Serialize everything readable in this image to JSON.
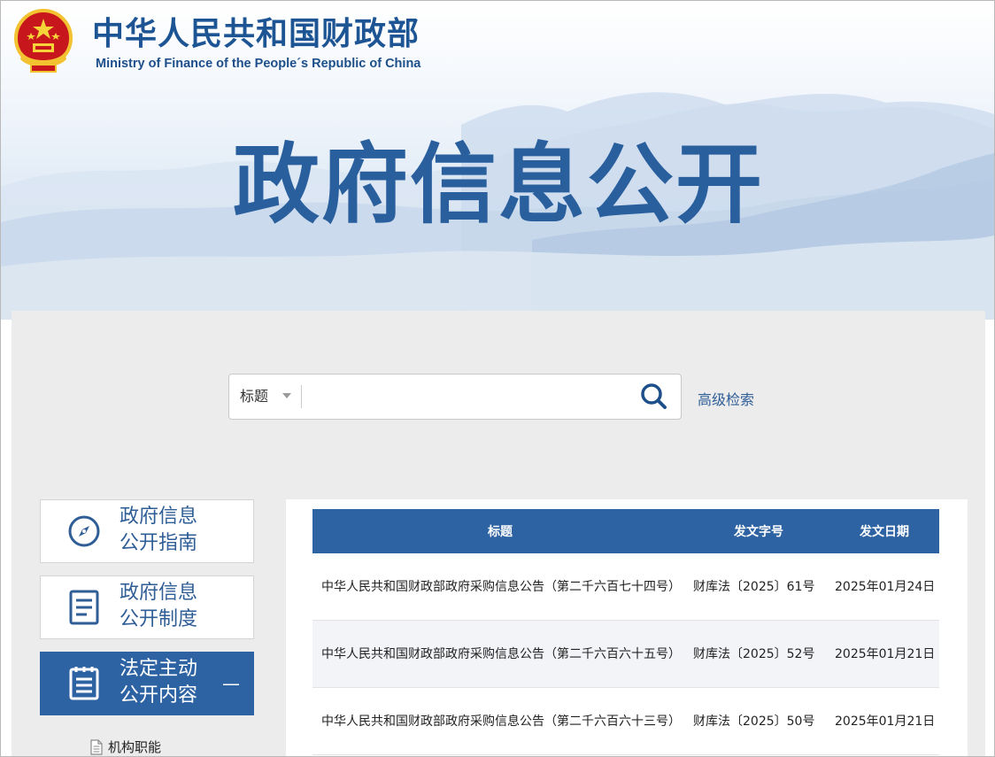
{
  "header": {
    "site_name": "中华人民共和国财政部",
    "site_name_en": "Ministry of Finance of the People´s Republic of China",
    "banner_title": "政府信息公开"
  },
  "search": {
    "type_label": "标题",
    "placeholder": "",
    "advanced_label": "高级检索",
    "icon": "search-icon"
  },
  "sidebar": {
    "items": [
      {
        "label": "政府信息\n公开指南",
        "icon": "compass-icon",
        "active": false
      },
      {
        "label": "政府信息\n公开制度",
        "icon": "document-icon",
        "active": false
      },
      {
        "label": "法定主动\n公开内容",
        "icon": "list-icon",
        "active": true,
        "toggle": "—"
      }
    ],
    "sub_items": [
      {
        "label": "机构职能",
        "icon": "file-icon"
      }
    ]
  },
  "table": {
    "headers": [
      "标题",
      "发文字号",
      "发文日期"
    ],
    "rows": [
      {
        "title": "中华人民共和国财政部政府采购信息公告（第二千六百七十四号）",
        "doc_no": "财库法〔2025〕61号",
        "date": "2025年01月24日"
      },
      {
        "title": "中华人民共和国财政部政府采购信息公告（第二千六百六十五号）",
        "doc_no": "财库法〔2025〕52号",
        "date": "2025年01月21日"
      },
      {
        "title": "中华人民共和国财政部政府采购信息公告（第二千六百六十三号）",
        "doc_no": "财库法〔2025〕50号",
        "date": "2025年01月21日"
      }
    ]
  },
  "colors": {
    "brand_blue": "#2e63a3",
    "title_blue": "#2a5f9e",
    "panel_gray": "#ececec"
  }
}
